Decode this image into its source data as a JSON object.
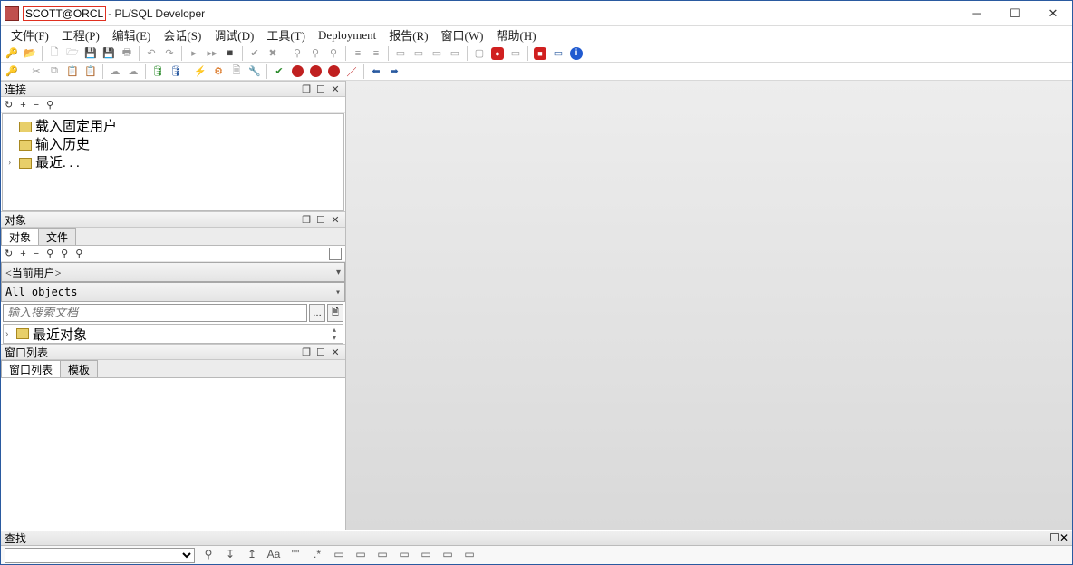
{
  "title": {
    "connection": "SCOTT@ORCL",
    "app": "- PL/SQL Developer"
  },
  "menu": {
    "file": "文件(F)",
    "project": "工程(P)",
    "edit": "编辑(E)",
    "session": "会话(S)",
    "debug": "调试(D)",
    "tools": "工具(T)",
    "deployment": "Deployment",
    "report": "报告(R)",
    "window": "窗口(W)",
    "help": "帮助(H)"
  },
  "panels": {
    "connections": {
      "title": "连接",
      "items": {
        "load_fixed": "载入固定用户",
        "input_history": "输入历史",
        "recent": "最近. . ."
      }
    },
    "objects": {
      "title": "对象",
      "tabs": {
        "objects": "对象",
        "files": "文件"
      },
      "user_dropdown": "<当前用户>",
      "filter_dropdown": "All objects",
      "search_placeholder": "输入搜索文档",
      "recent_objects": "最近对象"
    },
    "windowlist": {
      "title": "窗口列表",
      "tabs": {
        "list": "窗口列表",
        "template": "模板"
      }
    },
    "find": {
      "title": "查找"
    }
  },
  "icons": {
    "refresh": "↻",
    "plus": "+",
    "minus": "−",
    "binoculars1": "⚲",
    "binoculars2": "⚲",
    "binoculars3": "⚲",
    "restore": "❐",
    "maximize": "☐",
    "close": "✕"
  }
}
